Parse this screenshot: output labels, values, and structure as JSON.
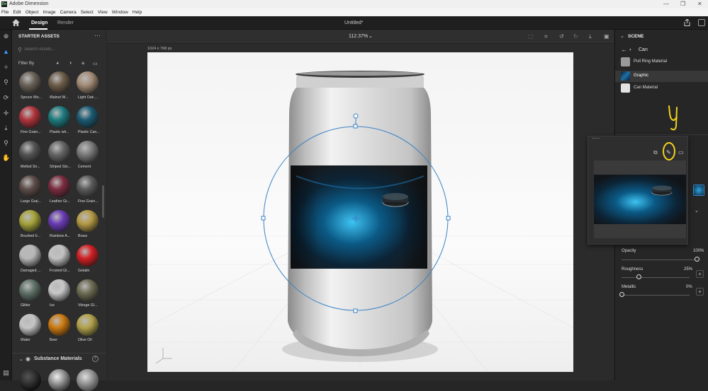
{
  "window": {
    "app_title": "Adobe Dimension",
    "logo": "Dn"
  },
  "menu": [
    "File",
    "Edit",
    "Object",
    "Image",
    "Camera",
    "Select",
    "View",
    "Window",
    "Help"
  ],
  "appbar": {
    "design_tab": "Design",
    "render_tab": "Render",
    "doc_title": "Untitled*",
    "zoom": "112.37%"
  },
  "left_panel": {
    "header": "STARTER ASSETS",
    "search_placeholder": "Search Assets...",
    "filter_label": "Filter By",
    "assets": [
      {
        "label": "Spruce Wo...",
        "color": "#6b6258"
      },
      {
        "label": "Walnut W...",
        "color": "#6e5d4a"
      },
      {
        "label": "Light Oak ...",
        "color": "#a58d77"
      },
      {
        "label": "Fine Grain...",
        "color": "#b2343c"
      },
      {
        "label": "Plastic wit...",
        "color": "#1d7c80"
      },
      {
        "label": "Plastic Can...",
        "color": "#1b5a73"
      },
      {
        "label": "Melted Sn...",
        "color": "#555"
      },
      {
        "label": "Striped Sto...",
        "color": "#676767"
      },
      {
        "label": "Cement",
        "color": "#7b7b7b"
      },
      {
        "label": "Large Grai...",
        "color": "#5e4d48"
      },
      {
        "label": "Leather Gr...",
        "color": "#7c2c3f"
      },
      {
        "label": "Fine Grain...",
        "color": "#5b5b5b"
      },
      {
        "label": "Brushed Ir...",
        "color": "#a6a43a"
      },
      {
        "label": "Rainbow A...",
        "color": "#6a3bb5"
      },
      {
        "label": "Brass",
        "color": "#b59a44"
      },
      {
        "label": "Damaged ...",
        "color": "#b8b8b8"
      },
      {
        "label": "Frosted Gl...",
        "color": "#c2c2c2"
      },
      {
        "label": "Gelatin",
        "color": "#d21f24"
      },
      {
        "label": "Glitter",
        "color": "#5f7269"
      },
      {
        "label": "Ice",
        "color": "#c8c8c8"
      },
      {
        "label": "Vitrage Gl...",
        "color": "#6e6d54"
      },
      {
        "label": "Water",
        "color": "#c5c5c5"
      },
      {
        "label": "Beer",
        "color": "#cc7a10"
      },
      {
        "label": "Olive Oil",
        "color": "#b2a24a"
      }
    ],
    "substance_header": "Substance Materials"
  },
  "canvas": {
    "size_label": "1024 x 768 px"
  },
  "right_panel": {
    "scene_header": "SCENE",
    "breadcrumb": "Can",
    "items": [
      {
        "label": "Pull Ring Material",
        "thumb": "#9a9a9a"
      },
      {
        "label": "Graphic",
        "thumb": "#1e6fa6"
      },
      {
        "label": "Can Material",
        "thumb": "#e2e2e2"
      }
    ],
    "opacity_label": "Opacity",
    "opacity_value": "100%",
    "opacity": 1.0,
    "roughness_label": "Roughness",
    "roughness_value": "25%",
    "roughness": 0.25,
    "metallic_label": "Metallic",
    "metallic_value": "0%",
    "metallic": 0.0
  },
  "annotation": {
    "text": "ч",
    "color": "#f2d21d"
  }
}
